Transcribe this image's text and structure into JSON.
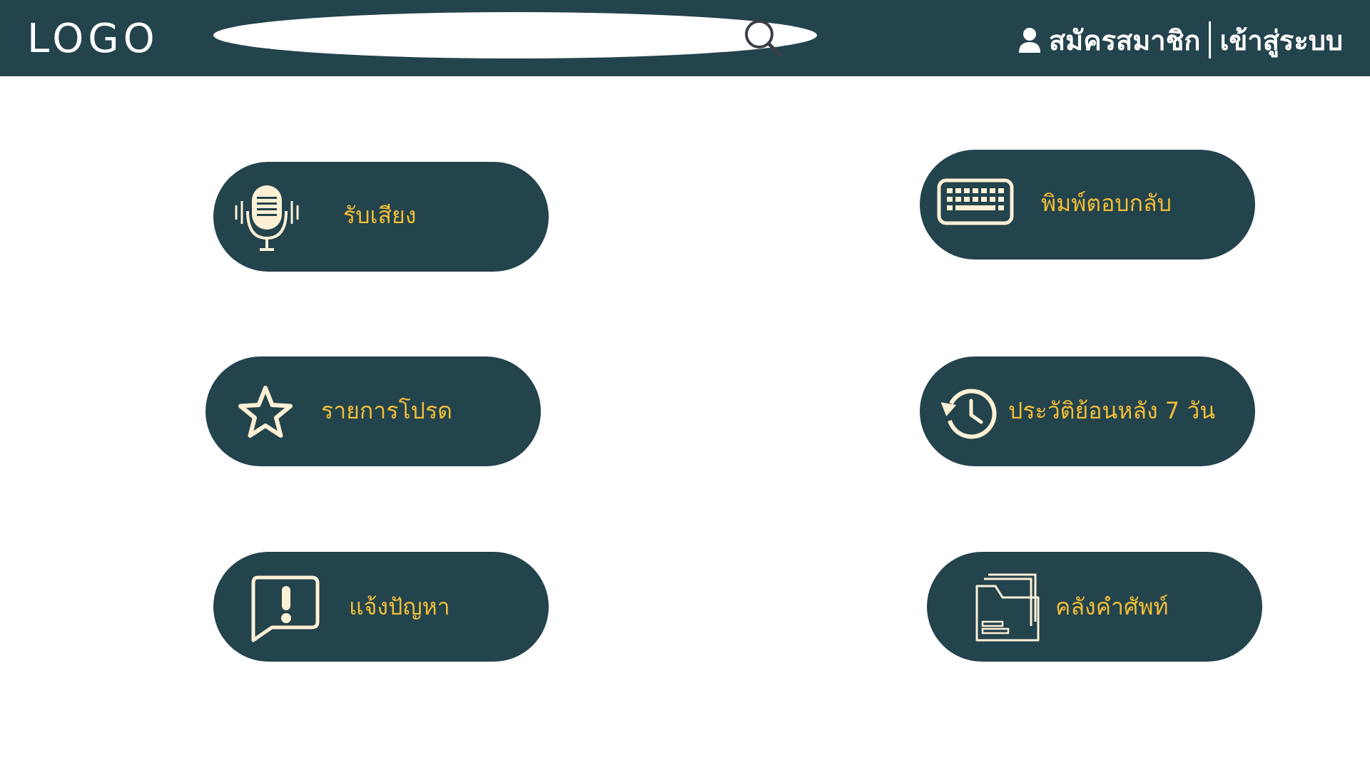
{
  "header": {
    "logo_text": "LOGO",
    "search": {
      "value": "",
      "placeholder": ""
    },
    "register_label": "สมัครสมาชิก",
    "login_label": "เข้าสู่ระบบ"
  },
  "menu": {
    "voice_label": "รับเสียง",
    "type_reply_label": "พิมพ์ตอบกลับ",
    "favorites_label": "รายการโปรด",
    "history_label": "ประวัติย้อนหลัง 7 วัน",
    "report_label": "แจ้งปัญหา",
    "vocab_label": "คลังคำศัพท์"
  },
  "colors": {
    "brand": "#23434d",
    "label": "#f2be35",
    "icon": "#fdf0d5",
    "background": "#ffffff"
  }
}
